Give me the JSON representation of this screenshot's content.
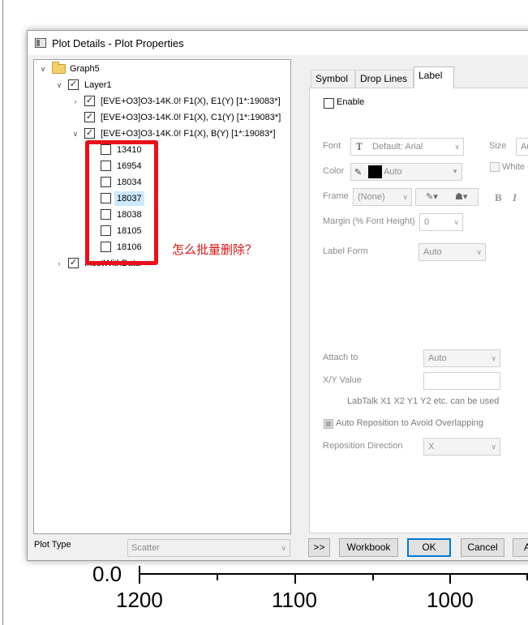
{
  "dialog": {
    "title": "Plot Details - Plot Properties"
  },
  "tree": {
    "graph": "Graph5",
    "layer": "Layer1",
    "plots": [
      "[EVE+O3]O3-14K.0! F1(X), E1(Y) [1*:19083*]",
      "[EVE+O3]O3-14K.0! F1(X), C1(Y) [1*:19083*]",
      "[EVE+O3]O3-14K.0! F1(X), B(Y) [1*:19083*]"
    ],
    "sub_items": [
      "13410",
      "16954",
      "18034",
      "18037",
      "18038",
      "18105",
      "18106"
    ],
    "selected_sub_item": "18037",
    "inset": "InsetWithData"
  },
  "annotation": "怎么批量删除？",
  "plot_type": {
    "label": "Plot Type",
    "value": "Scatter"
  },
  "tabs": [
    "Symbol",
    "Drop Lines",
    "Label"
  ],
  "active_tab": "Label",
  "label_tab": {
    "enable": "Enable",
    "font_label": "Font",
    "font_value": "Default: Arial",
    "size_label": "Size",
    "size_value": "Au",
    "color_label": "Color",
    "color_value": "Auto",
    "white_label": "White O",
    "frame_label": "Frame",
    "frame_value": "(None)",
    "margin_label": "Margin (% Font Height)",
    "margin_value": "0",
    "label_form_label": "Label Form",
    "label_form_value": "Auto",
    "attach_to_label": "Attach to",
    "attach_to_value": "Auto",
    "xy_value_label": "X/Y Value",
    "labtalk_hint": "LabTalk X1 X2 Y1 Y2 etc. can be used",
    "auto_reposition": "Auto Reposition to Avoid Overlapping",
    "reposition_dir_label": "Reposition Direction",
    "reposition_dir_value": "X",
    "bold": "B",
    "italic": "I"
  },
  "buttons": {
    "expand": ">>",
    "workbook": "Workbook",
    "ok": "OK",
    "cancel": "Cancel",
    "apply": "A"
  },
  "axis": {
    "y_tick": "0.0",
    "x_ticks": [
      "1200",
      "1100",
      "1000"
    ]
  },
  "colors": {
    "highlight": "#e8101a",
    "selection": "#cde8ff",
    "default_button_border": "#0078d7"
  }
}
